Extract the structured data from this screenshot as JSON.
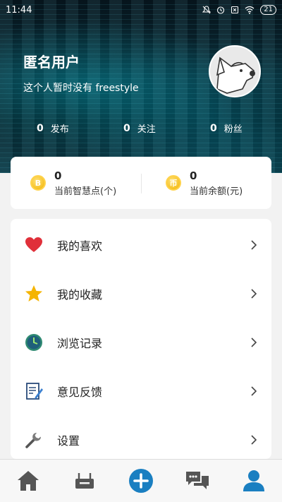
{
  "status_bar": {
    "time": "11:44",
    "battery": "21"
  },
  "profile": {
    "username": "匿名用户",
    "bio": "这个人暂时没有 freestyle",
    "stats": [
      {
        "count": "0",
        "label": "发布"
      },
      {
        "count": "0",
        "label": "关注"
      },
      {
        "count": "0",
        "label": "粉丝"
      }
    ]
  },
  "wallet": {
    "items": [
      {
        "value": "0",
        "label": "当前智慧点(个)",
        "coin_glyph": "B"
      },
      {
        "value": "0",
        "label": "当前余额(元)",
        "coin_glyph": "币"
      }
    ]
  },
  "menu": {
    "items": [
      {
        "label": "我的喜欢",
        "icon": "heart-icon"
      },
      {
        "label": "我的收藏",
        "icon": "star-icon"
      },
      {
        "label": "浏览记录",
        "icon": "clock-icon"
      },
      {
        "label": "意见反馈",
        "icon": "feedback-icon"
      },
      {
        "label": "设置",
        "icon": "wrench-icon"
      }
    ]
  },
  "tabbar": {
    "items": [
      {
        "icon": "home-icon"
      },
      {
        "icon": "router-icon"
      },
      {
        "icon": "add-icon"
      },
      {
        "icon": "chat-icon"
      },
      {
        "icon": "profile-icon"
      }
    ],
    "active_color": "#1a7fc1"
  },
  "colors": {
    "accent": "#1a7fc1",
    "heart": "#e0303a",
    "star": "#f5b400",
    "clock": "#2f8a72",
    "coin": "#f2b300"
  }
}
